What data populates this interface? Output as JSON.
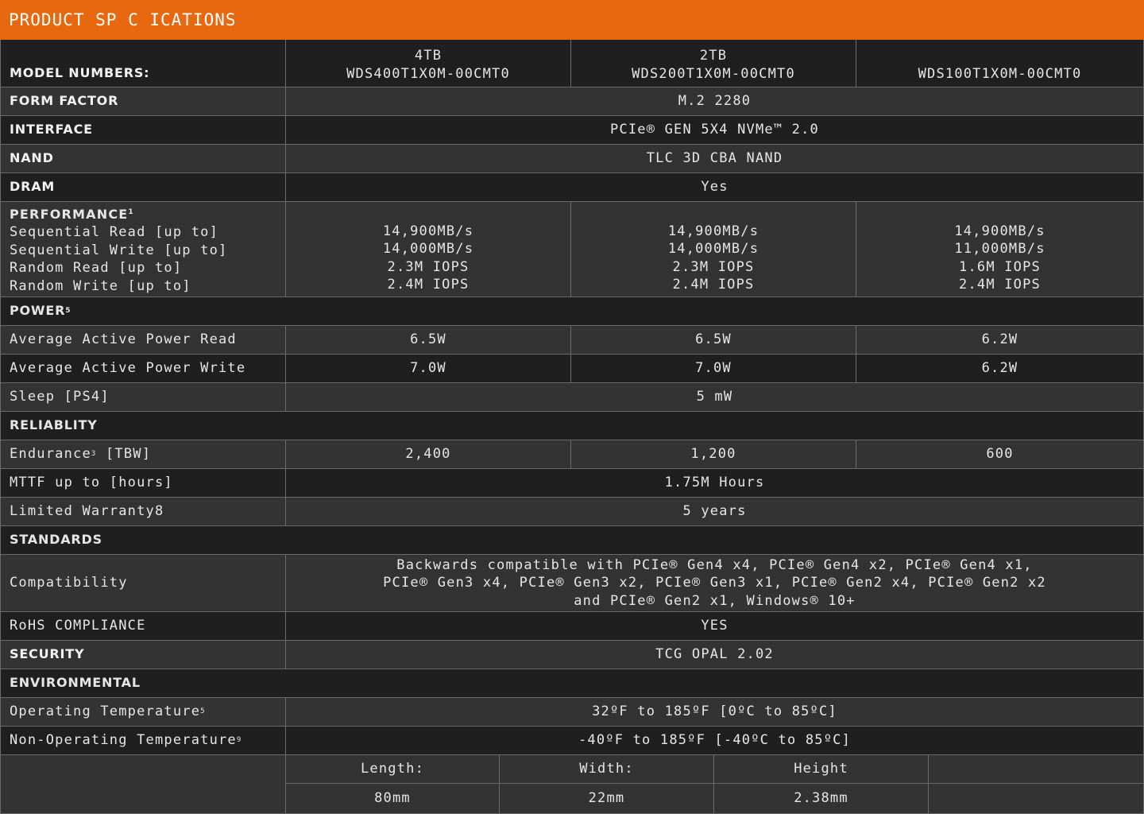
{
  "header": {
    "title": "PRODUCT SP C  ICATIONS"
  },
  "model": {
    "label": "MODEL NUMBERS:",
    "columns": [
      {
        "capacity": "4TB",
        "number": "WDS400T1X0M-00CMT0"
      },
      {
        "capacity": "2TB",
        "number": "WDS200T1X0M-00CMT0"
      },
      {
        "capacity": "",
        "number": "WDS100T1X0M-00CMT0"
      }
    ]
  },
  "form_factor": {
    "label": "FORM FACTOR",
    "value": "M.2 2280"
  },
  "interface": {
    "label": "INTERFACE",
    "value": "PCIe® GEN 5X4 NVMe™ 2.0"
  },
  "nand": {
    "label": "NAND",
    "value": "TLC 3D CBA NAND"
  },
  "dram": {
    "label": "DRAM",
    "value": "Yes"
  },
  "performance": {
    "heading": "PERFORMANCE",
    "heading_sup": "1",
    "lines": [
      "Sequential Read [up to]",
      "Sequential Write [up to]",
      "Random Read [up to]",
      "Random Write [up to]"
    ],
    "columns": [
      "14,900MB/s\n14,000MB/s\n2.3M IOPS\n2.4M IOPS",
      "14,900MB/s\n14,000MB/s\n2.3M IOPS\n2.4M IOPS",
      "14,900MB/s\n11,000MB/s\n1.6M IOPS\n2.4M IOPS"
    ]
  },
  "power": {
    "heading": "POWER",
    "heading_sup": "5",
    "read": {
      "label": "Average Active Power Read",
      "values": [
        "6.5W",
        "6.5W",
        "6.2W"
      ]
    },
    "write": {
      "label": "Average Active Power Write",
      "values": [
        "7.0W",
        "7.0W",
        "6.2W"
      ]
    },
    "sleep": {
      "label": "Sleep [PS4]",
      "value": "5 mW"
    }
  },
  "reliability": {
    "heading": "RELIABLITY",
    "endurance": {
      "label": "Endurance",
      "label_sup": "3",
      "label_suffix": " [TBW]",
      "values": [
        "2,400",
        "1,200",
        "600"
      ]
    },
    "mttf": {
      "label": "MTTF up to [hours]",
      "value": "1.75M Hours"
    },
    "warranty": {
      "label": "Limited Warranty8",
      "value": "5 years"
    }
  },
  "standards": {
    "heading": "STANDARDS",
    "compatibility": {
      "label": "Compatibility",
      "value": "Backwards compatible with PCIe® Gen4 x4, PCIe® Gen4 x2, PCIe® Gen4 x1,\nPCIe® Gen3 x4, PCIe® Gen3 x2, PCIe® Gen3 x1, PCIe® Gen2 x4, PCIe® Gen2 x2\nand PCIe® Gen2 x1, Windows® 10+"
    },
    "rohs": {
      "label": "RoHS COMPLIANCE",
      "value": "YES"
    },
    "security": {
      "label": "SECURITY",
      "value": "TCG OPAL 2.02"
    }
  },
  "environmental": {
    "heading": "ENVIRONMENTAL",
    "operating": {
      "label": "Operating Temperature",
      "label_sup": "5",
      "value": "32ºF to 185ºF [0ºC to 85ºC]"
    },
    "non_operating": {
      "label": "Non-Operating Temperature",
      "label_sup": "9",
      "value": "-40ºF to 185ºF [-40ºC to 85ºC]"
    }
  },
  "dimensions": {
    "headers": [
      "Length:",
      "Width:",
      "Height",
      ""
    ],
    "values": [
      "80mm",
      "22mm",
      "2.38mm",
      ""
    ]
  }
}
